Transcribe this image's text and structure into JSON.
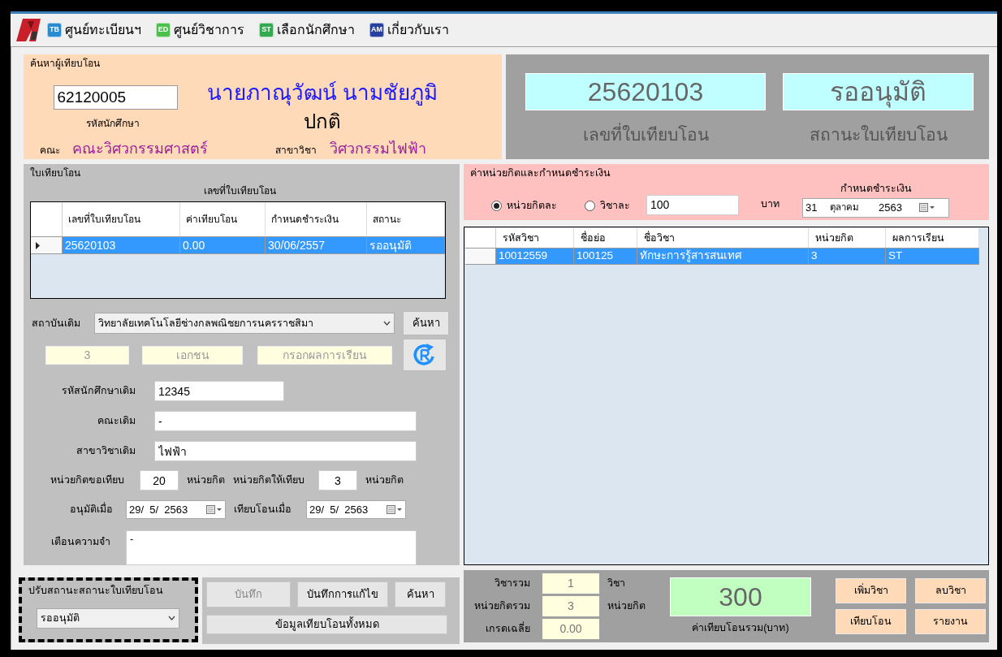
{
  "menu": [
    {
      "badge": "TB",
      "label": "ศูนย์ทะเบียนฯ",
      "color": "#2a8bd0"
    },
    {
      "badge": "ED",
      "label": "ศูนย์วิชาการ",
      "color": "#4cbf4c"
    },
    {
      "badge": "ST",
      "label": "เลือกนักศึกษา",
      "color": "#35a852"
    },
    {
      "badge": "AM",
      "label": "เกี่ยวกับเรา",
      "color": "#2840a0"
    }
  ],
  "search_panel": {
    "title": "ค้นหาผู้เทียบโอน",
    "student_id": "62120005",
    "student_id_label": "รหัสนักศึกษา",
    "student_name": "นายภาณุวัฒน์ นามชัยภูมิ",
    "student_status": "ปกติ",
    "faculty_label": "คณะ",
    "faculty": "คณะวิศวกรรมศาสตร์",
    "major_label": "สาขาวิชา",
    "major": "วิศวกรรมไฟฟ้า"
  },
  "summary": {
    "transfer_no": "25620103",
    "transfer_no_label": "เลขที่ใบเทียบโอน",
    "status": "รออนุมัติ",
    "status_label": "สถานะใบเทียบโอน"
  },
  "transfer_form": {
    "title": "ใบเทียบโอน",
    "table_caption": "เลขที่ใบเทียบโอน",
    "table": {
      "columns": [
        "เลขที่ใบเทียบโอน",
        "ค่าเทียบโอน",
        "กำหนดชำระเงิน",
        "สถานะ"
      ],
      "rows": [
        {
          "cells": [
            "25620103",
            "0.00",
            "30/06/2557",
            "รออนุมัติ"
          ],
          "selected": true
        }
      ]
    },
    "institution_label": "สถาบันเดิม",
    "institution": "วิทยาลัยเทคโนโลยีช่างกลพณิชยการนครราชสิมา",
    "search_button": "ค้นหา",
    "info": [
      "3",
      "เอกชน",
      "กรอกผลการเรียน"
    ],
    "old_student_id": {
      "label": "รหัสนักศึกษาเดิม",
      "value": "12345"
    },
    "old_faculty": {
      "label": "คณะเดิม",
      "value": "-"
    },
    "old_major": {
      "label": "สาขาวิชาเดิม",
      "value": "ไฟฟ้า"
    },
    "credits_requested": {
      "label": "หน่วยกิตขอเทียบ",
      "value": "20",
      "unit": "หน่วยกิต"
    },
    "credits_granted": {
      "label": "หน่วยกิตให้เทียบ",
      "value": "3",
      "unit": "หน่วยกิต"
    },
    "approved_on": {
      "label": "อนุมัติเมื่อ",
      "value": "29/  5/  2563"
    },
    "transferred_on": {
      "label": "เทียบโอนเมื่อ",
      "value": "29/  5/  2563"
    },
    "reminder": {
      "label": "เตือนความจำ",
      "value": "-"
    }
  },
  "status_panel": {
    "title": "ปรับสถานะสถานะใบเทียบโอน",
    "value": "รออนุมัติ"
  },
  "actions": [
    {
      "label": "บันทึก",
      "disabled": true
    },
    {
      "label": "บันทึกการแก้ไข",
      "disabled": false
    },
    {
      "label": "ค้นหา",
      "disabled": false
    },
    {
      "label": "ข้อมูลเทียบโอนทั้งหมด",
      "disabled": false
    }
  ],
  "fee_panel": {
    "title": "ค่าหน่วยกิตและกำหนดชำระเงิน",
    "options": [
      {
        "label": "หน่วยกิตละ",
        "selected": true
      },
      {
        "label": "วิชาละ",
        "selected": false
      }
    ],
    "amount": "100",
    "currency": "บาท",
    "due_label": "กำหนดชำระเงิน",
    "due_day": "31",
    "due_month": "ตุลาคม",
    "due_year": "2563"
  },
  "courses": {
    "columns": [
      "รหัสวิชา",
      "ชื่อย่อ",
      "ชื่อวิชา",
      "หน่วยกิต",
      "ผลการเรียน"
    ],
    "rows": [
      {
        "cells": [
          "10012559",
          "100125",
          "ทักษะการรู้สารสนเทศ",
          "3",
          "ST"
        ],
        "selected": true
      }
    ]
  },
  "totals": {
    "rows": [
      {
        "label": "วิชารวม",
        "value": "1",
        "unit": "วิชา"
      },
      {
        "label": "หน่วยกิตรวม",
        "value": "3",
        "unit": "หน่วยกิต"
      },
      {
        "label": "เกรดเฉลี่ย",
        "value": "0.00"
      }
    ],
    "total_fee": "300",
    "total_fee_label": "ค่าเทียบโอนรวม(บาท)",
    "buttons": [
      "เพิ่มวิชา",
      "ลบวิชา",
      "เทียบโอน",
      "รายงาน"
    ]
  }
}
